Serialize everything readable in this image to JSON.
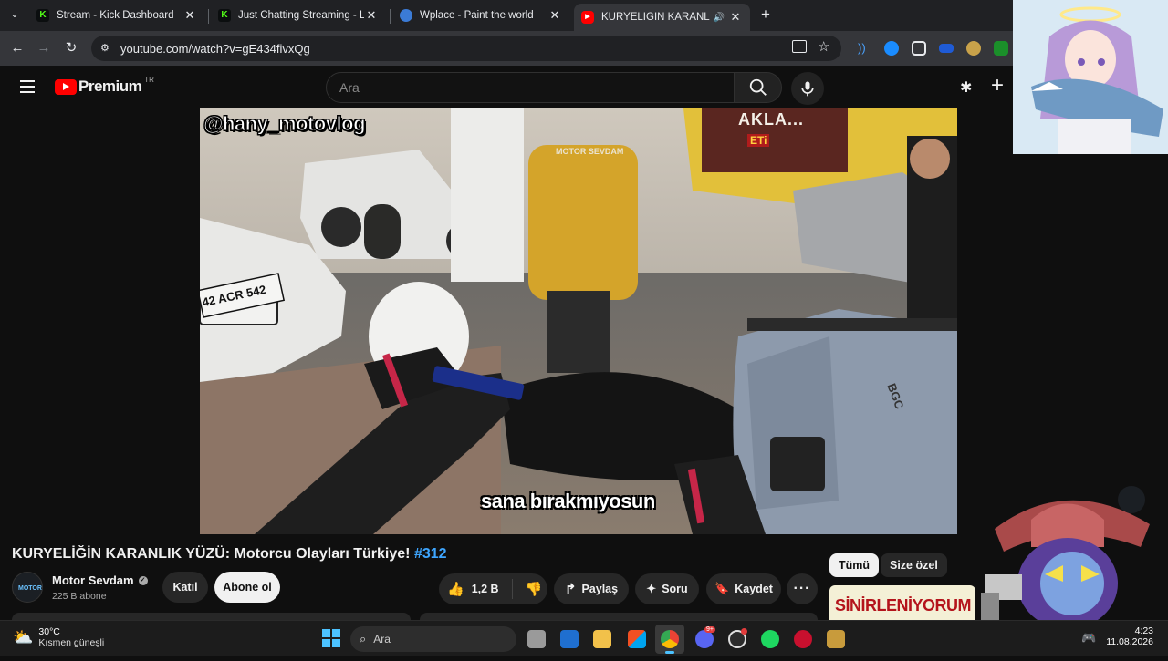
{
  "browser": {
    "tabs": [
      {
        "title": "Stream - Kick Dashboard",
        "icon": "kick-icon",
        "active": false
      },
      {
        "title": "Just Chatting Streaming - Live S",
        "icon": "kick-icon",
        "active": false
      },
      {
        "title": "Wplace - Paint the world",
        "icon": "globe-icon",
        "active": false
      },
      {
        "title": "KURYELİĞİN KARANLIK YÜZ",
        "icon": "youtube-icon",
        "active": true
      }
    ],
    "url": "youtube.com/watch?v=gE434fivxQg"
  },
  "youtube": {
    "logo_text": "Premium",
    "logo_region": "TR",
    "search_placeholder": "Ara"
  },
  "video": {
    "watermark_handle": "@hany_motovlog",
    "watermark_brand": "MOTOR SEVDAM",
    "subtitle": "sana bırakmıyosun",
    "plate_text": "42 ACR 542",
    "sign_text": "AKLA...",
    "sign_brand": "ETi",
    "box_brand": "BGC",
    "title_main": "KURYELİĞİN KARANLIK YÜZÜ: Motorcu Olayları Türkiye! ",
    "title_tag": "#312"
  },
  "channel": {
    "name": "Motor Sevdam",
    "subscribers": "225 B abone",
    "join_label": "Katıl",
    "subscribe_label": "Abone ol"
  },
  "actions": {
    "likes": "1,2 B",
    "share": "Paylaş",
    "ask": "Soru",
    "save": "Kaydet"
  },
  "sidebar_chips": [
    "Tümü",
    "Size özel"
  ],
  "sidebar_thumb_text": "SİNİRLENİYORUM BA",
  "taskbar": {
    "weather_temp": "30°C",
    "weather_desc": "Kısmen güneşli",
    "search_label": "Ara",
    "time": "4:23",
    "date": "11.08.2026",
    "discord_badge": "9+"
  },
  "colors": {
    "youtube_red": "#ff0000",
    "link_blue": "#3ea6ff",
    "kick_green": "#53fc18"
  }
}
